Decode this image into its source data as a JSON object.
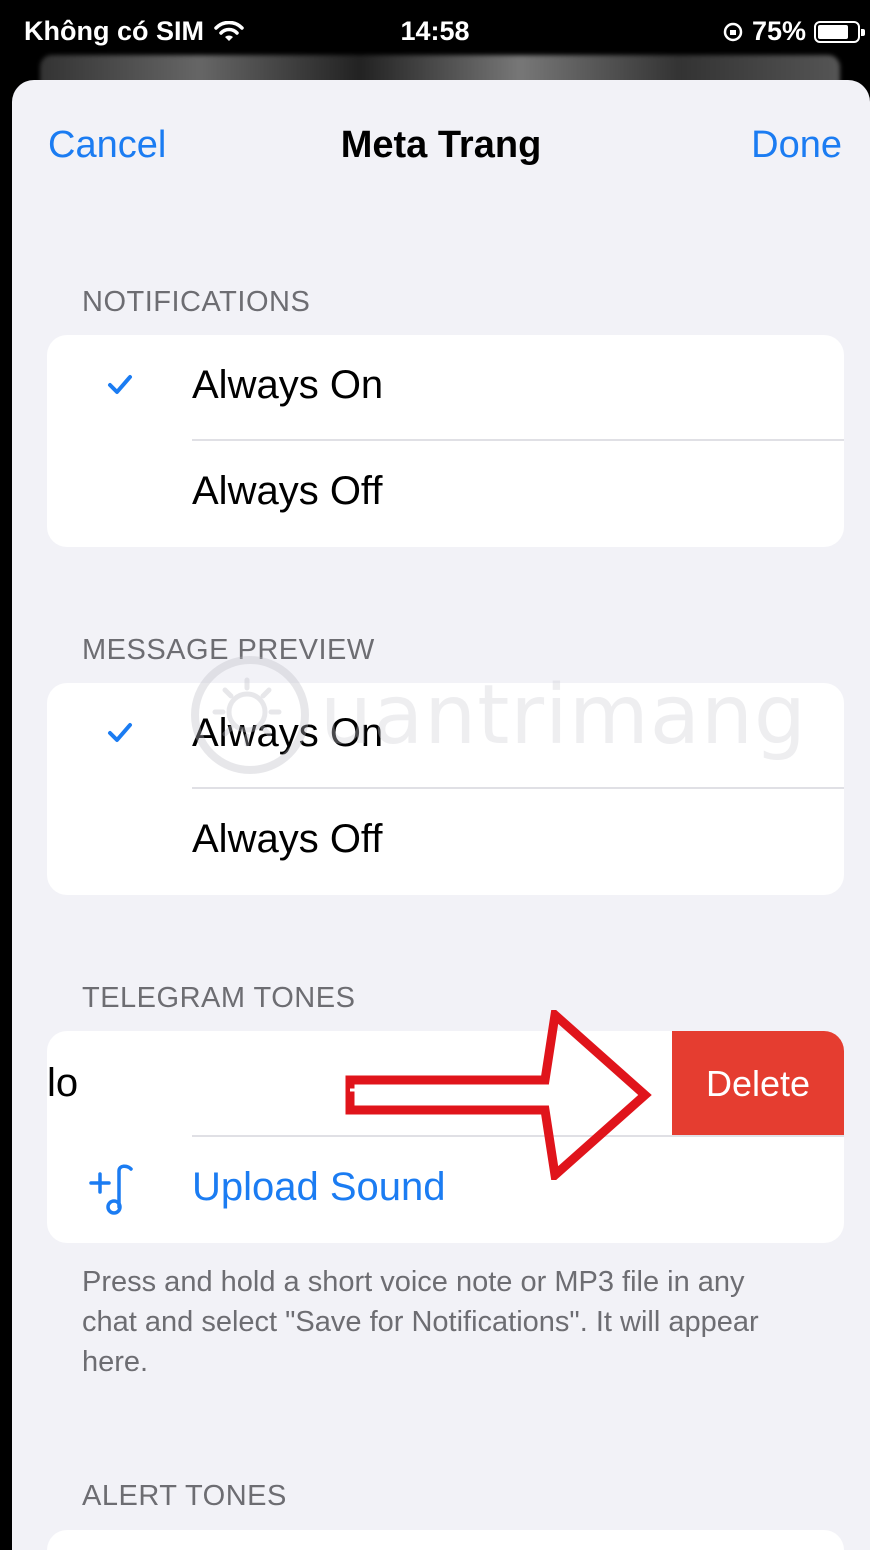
{
  "status_bar": {
    "carrier": "Không có SIM",
    "time": "14:58",
    "battery": "75%"
  },
  "nav": {
    "cancel": "Cancel",
    "title": "Meta Trang",
    "done": "Done"
  },
  "notifications": {
    "header": "NOTIFICATIONS",
    "options": [
      {
        "label": "Always On",
        "selected": true
      },
      {
        "label": "Always Off",
        "selected": false
      }
    ]
  },
  "message_preview": {
    "header": "MESSAGE PREVIEW",
    "options": [
      {
        "label": "Always On",
        "selected": true
      },
      {
        "label": "Always Off",
        "selected": false
      }
    ]
  },
  "telegram_tones": {
    "header": "TELEGRAM TONES",
    "tone_name": "lo",
    "delete_label": "Delete",
    "upload_label": "Upload Sound",
    "footnote": "Press and hold a short voice note or MP3 file in any chat and select \"Save for Notifications\". It will appear here."
  },
  "alert_tones": {
    "header": "ALERT TONES"
  },
  "watermark": "uantrimang",
  "colors": {
    "accent": "#1b7cf2",
    "delete": "#e53d30",
    "background": "#f2f2f7",
    "arrow": "#e0141b"
  },
  "icons": {
    "checkmark": "checkmark-icon",
    "upload": "music-note-plus-icon",
    "wifi": "wifi-icon",
    "battery": "battery-icon"
  }
}
